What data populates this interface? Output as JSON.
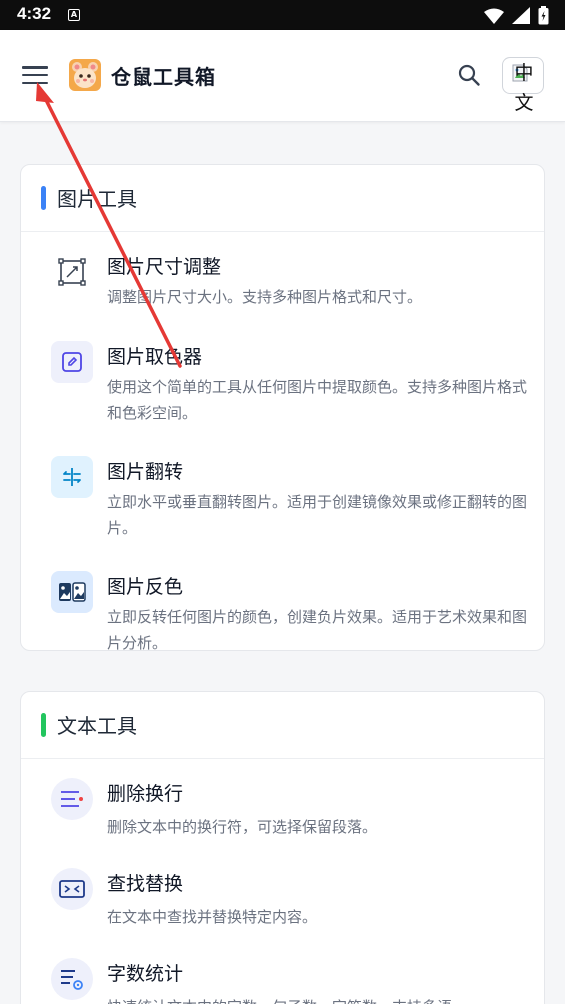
{
  "status_bar": {
    "time": "4:32",
    "notification_icon": "A"
  },
  "header": {
    "app_title": "仓鼠工具箱",
    "language_label_line1": "中",
    "language_label_line2": "文"
  },
  "sections": [
    {
      "title": "图片工具",
      "accent_color": "#3b82f6",
      "tools": [
        {
          "name": "图片尺寸调整",
          "description": "调整图片尺寸大小。支持多种图片格式和尺寸。",
          "icon": "image-resize-icon"
        },
        {
          "name": "图片取色器",
          "description": "使用这个简单的工具从任何图片中提取颜色。支持多种图片格式和色彩空间。",
          "icon": "color-picker-icon"
        },
        {
          "name": "图片翻转",
          "description": "立即水平或垂直翻转图片。适用于创建镜像效果或修正翻转的图片。",
          "icon": "flip-icon"
        },
        {
          "name": "图片反色",
          "description": "立即反转任何图片的颜色，创建负片效果。适用于艺术效果和图片分析。",
          "icon": "invert-icon"
        }
      ]
    },
    {
      "title": "文本工具",
      "accent_color": "#22c55e",
      "tools": [
        {
          "name": "删除换行",
          "description": "删除文本中的换行符，可选择保留段落。",
          "icon": "remove-linebreak-icon"
        },
        {
          "name": "查找替换",
          "description": "在文本中查找并替换特定内容。",
          "icon": "find-replace-icon"
        },
        {
          "name": "字数统计",
          "description": "快速统计文本中的字数、句子数、字符数，支持多语",
          "icon": "word-count-icon"
        }
      ]
    }
  ],
  "colors": {
    "annotation_arrow": "#e53935"
  }
}
